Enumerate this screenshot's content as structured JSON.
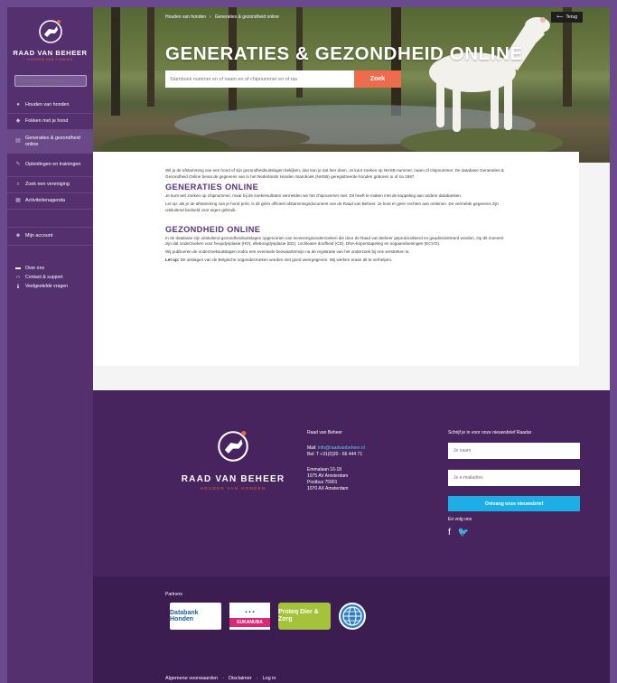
{
  "sidebar": {
    "logo_title": "RAAD VAN BEHEER",
    "logo_subtitle": "HOUDEN VAN HONDEN",
    "search_placeholder": "Zoek ras of onderwerp",
    "nav": [
      {
        "label": "Houden van honden",
        "icon": "paw-icon"
      },
      {
        "label": "Fokken met je hond",
        "icon": "dog-icon"
      },
      {
        "label": "Generaties & gezondheid online",
        "icon": "chart-icon",
        "active": true
      },
      {
        "label": "Opleidingen en trainingen",
        "icon": "education-icon"
      },
      {
        "label": "Zoek een vereniging",
        "icon": "search-icon"
      },
      {
        "label": "Activiteitenagenda",
        "icon": "calendar-icon"
      },
      {
        "label": "Mijn account",
        "icon": "user-icon"
      }
    ],
    "bottom_links": [
      {
        "label": "Over ons",
        "icon": "dog-icon"
      },
      {
        "label": "Contact & support",
        "icon": "headset-icon"
      },
      {
        "label": "Veelgestelde vragen",
        "icon": "info-icon"
      }
    ]
  },
  "hero": {
    "breadcrumb": [
      "Houden van honden",
      "Generaties & gezondheid online"
    ],
    "back_label": "Terug",
    "title": "GENERATIES & GEZONDHEID ONLINE",
    "search_placeholder": "Stamboek nummer en of naam en of chipnummer en of ras",
    "search_button": "Zoek"
  },
  "content": {
    "intro": "Wil je de afstamming van een hond of zijn gezondheidsuitslagen bekijken, dan kun je dat hier doen. Je kunt zoeken op NHSB-nummer, naam of chipnummer. De database Generaties & Gezondheid Online bevat de gegevens van in het Nederlands Honden Stamboek (NHSB) geregistreerde honden geboren in of na 1997.",
    "h1": "GENERATIES ONLINE",
    "p1": "Je kunt wel zoeken op chipnummer, maar bij de zoekresultaten vermelden we het chipnummer niet. Dit heeft te maken met de koppeling aan andere databanken.",
    "p2": "Let op: als je de afstamming van je hond print, is dit géén officieel afstammingsdocument van de Raad van Beheer. Je kunt er geen rechten aan ontlenen. De vermelde gegevens zijn uitsluitend bedoeld voor eigen gebruik.",
    "h2": "GEZONDHEID ONLINE",
    "p3": "In de database zijn uitsluitend gezondheidsuitslagen opgenomen van screeningsonderzoeken die door de Raad van Beheer geprotocolleerd en geadministreerd worden. Op dit moment zijn dat onderzoeken voor heupdysplasie (HD), elleboogdysplasie (ED), cochleaire doofheid (CD), DNA-koperstapeling en oogaandoeningen (ECVO).",
    "p4": "Wij publiceren de onderzoeksuitslagen zodra een eventuele bezwaartermijn na de registratie van het onderzoek bij ons verstreken is.",
    "p5_bold": "Let op:",
    "p5": " De uitslagen van de Belgische oogonderzoeken worden niet goed weergegeven. Wij werken eraan dit te verhelpen."
  },
  "footer": {
    "logo_title": "RAAD VAN BEHEER",
    "logo_subtitle": "HOUDEN VAN HONDEN",
    "org": "Raad van Beheer",
    "mail_label": "Mail:",
    "mail": "info@raadvanbeheer.nl",
    "phone": "Bel: T +31(0)20 - 66 444 71",
    "address": [
      "Emmalaan 16-18",
      "1075 AV Amsterdam",
      "Postbus 75901",
      "1070 AX Amsterdam"
    ],
    "newsletter_title": "Schrijf je in voor onze nieuwsbrief Raadar",
    "name_placeholder": "Je naam",
    "email_placeholder": "Je e-mailadres",
    "subscribe_button": "Ontvang onze nieuwsbrief",
    "follow": "En volg ons"
  },
  "partners": {
    "title": "Partners",
    "logos": [
      "Databank Honden",
      "EUKANUBA",
      "Proteq Dier & Zorg",
      "FCI"
    ],
    "links": [
      "Algemene voorwaarden",
      "Disclaimer",
      "Log in"
    ],
    "separator": "·"
  },
  "colors": {
    "sidebar": "#54306f",
    "footer": "#47245e",
    "accent": "#ee6b4d",
    "subscribe": "#1daee6"
  }
}
